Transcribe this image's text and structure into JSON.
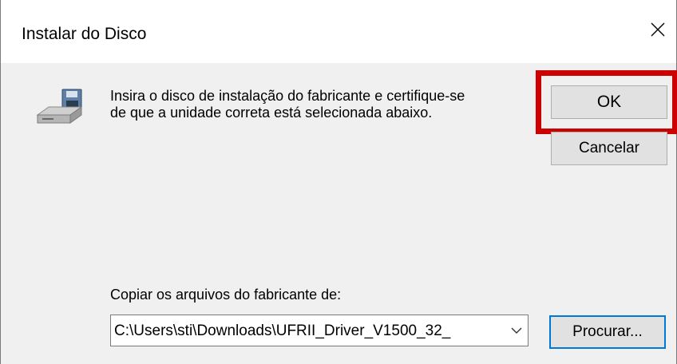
{
  "dialog": {
    "title": "Instalar do Disco",
    "message": "Insira o disco de instalação do fabricante e certifique-se\nde que a unidade correta está selecionada abaixo.",
    "copy_label": "Copiar os arquivos do fabricante de:",
    "path_value": "C:\\Users\\sti\\Downloads\\UFRII_Driver_V1500_32_",
    "buttons": {
      "ok": "OK",
      "cancel": "Cancelar",
      "browse": "Procurar..."
    }
  },
  "icons": {
    "close": "close-icon",
    "disk": "floppy-disk-drive-icon",
    "dropdown": "chevron-down-icon"
  },
  "colors": {
    "highlight": "#cc0000",
    "focus_border": "#0078d7",
    "dialog_background": "#f0f0f0"
  }
}
